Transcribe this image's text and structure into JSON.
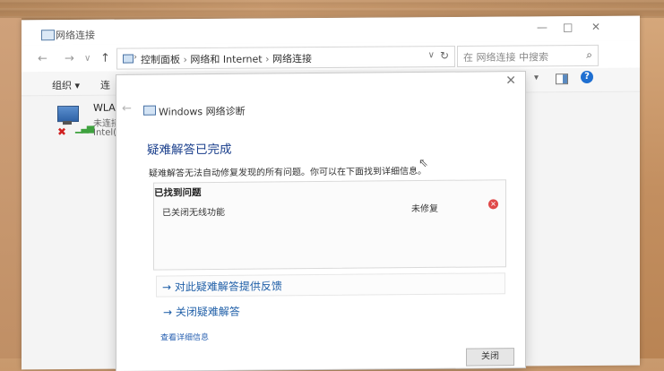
{
  "explorer": {
    "title": "网络连接",
    "window_buttons": [
      "—",
      "□",
      "✕"
    ],
    "breadcrumb": [
      "控制面板",
      "网络和 Internet",
      "网络连接"
    ],
    "search_placeholder": "在 网络连接 中搜索",
    "toolbar": {
      "organize": "组织 ▾",
      "connect": "连"
    },
    "adapter": {
      "name": "WLAN",
      "status": "未连接",
      "device": "Intel("
    }
  },
  "dialog": {
    "close": "✕",
    "app_title": "Windows 网络诊断",
    "heading": "疑难解答已完成",
    "description": "疑难解答无法自动修复发现的所有问题。你可以在下面找到详细信息。",
    "problems_title": "已找到问题",
    "issues": [
      {
        "text": "已关闭无线功能",
        "status": "未修复"
      }
    ],
    "link_feedback": "→ 对此疑难解答提供反馈",
    "link_close": "→ 关闭疑难解答",
    "details_link": "查看详细信息",
    "close_button": "关闭"
  },
  "icons": {
    "back": "back-arrow-icon",
    "forward": "forward-arrow-icon",
    "up": "up-arrow-icon",
    "search": "search-icon",
    "error": "error-x-icon",
    "help": "help-icon"
  },
  "colors": {
    "heading": "#1a3f8c",
    "link": "#1f5fa8",
    "error": "#e04848",
    "help": "#1f6fd1"
  }
}
